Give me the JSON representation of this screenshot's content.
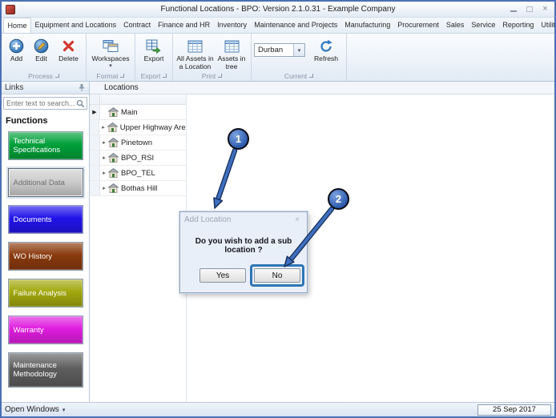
{
  "window": {
    "title": "Functional Locations - BPO: Version 2.1.0.31 - Example Company"
  },
  "icons": {
    "close": "×",
    "dropdown": "▾",
    "expander": "▸",
    "row_indicator": "▶"
  },
  "ribbon": {
    "tabs": [
      "Home",
      "Equipment and Locations",
      "Contract",
      "Finance and HR",
      "Inventory",
      "Maintenance and Projects",
      "Manufacturing",
      "Procurement",
      "Sales",
      "Service",
      "Reporting",
      "Utilities"
    ],
    "active_tab": "Home",
    "process": {
      "caption": "Process",
      "add": "Add",
      "edit": "Edit",
      "delete": "Delete"
    },
    "format": {
      "caption": "Format",
      "workspaces": "Workspaces"
    },
    "export_group": {
      "caption": "Export",
      "export": "Export"
    },
    "print": {
      "caption": "Print",
      "all_assets": "All Assets in a Location",
      "assets_in_tree": "Assets in tree"
    },
    "current": {
      "caption": "Current",
      "site": "Durban",
      "refresh": "Refresh"
    }
  },
  "sidebar": {
    "header": "Links",
    "search_placeholder": "Enter text to search...",
    "functions_label": "Functions",
    "items": [
      {
        "label": "Technical Specifications",
        "bg": "#00a03a",
        "fg": "#ffffff",
        "selected": false
      },
      {
        "label": "Additional Data",
        "bg": "#cdcdcd",
        "fg": "#6e6e6e",
        "selected": true
      },
      {
        "label": "Documents",
        "bg": "#2214ea",
        "fg": "#ffffff",
        "selected": false
      },
      {
        "label": "WO History",
        "bg": "#8a3a0e",
        "fg": "#ffffff",
        "selected": false
      },
      {
        "label": "Failure Analysis",
        "bg": "#a2a80e",
        "fg": "#ffffff",
        "selected": false
      },
      {
        "label": "Warranty",
        "bg": "#df1ddf",
        "fg": "#ffffff",
        "selected": false
      },
      {
        "label": "Maintenance Methodology",
        "bg": "#5e5e5e",
        "fg": "#ffffff",
        "selected": false
      }
    ]
  },
  "locations": {
    "caption": "Locations",
    "items": [
      {
        "label": "Main",
        "expandable": false,
        "focused": true
      },
      {
        "label": "Upper Highway Area",
        "expandable": true,
        "focused": false
      },
      {
        "label": "Pinetown",
        "expandable": true,
        "focused": false
      },
      {
        "label": "BPO_RSI",
        "expandable": true,
        "focused": false
      },
      {
        "label": "BPO_TEL",
        "expandable": true,
        "focused": false
      },
      {
        "label": "Bothas Hill",
        "expandable": true,
        "focused": false
      }
    ]
  },
  "dialog": {
    "title": "Add Location",
    "message": "Do you wish to add a sub location ?",
    "yes": "Yes",
    "no": "No"
  },
  "callouts": [
    {
      "number": "1"
    },
    {
      "number": "2"
    }
  ],
  "statusbar": {
    "open_windows": "Open Windows",
    "date": "25 Sep 2017"
  }
}
